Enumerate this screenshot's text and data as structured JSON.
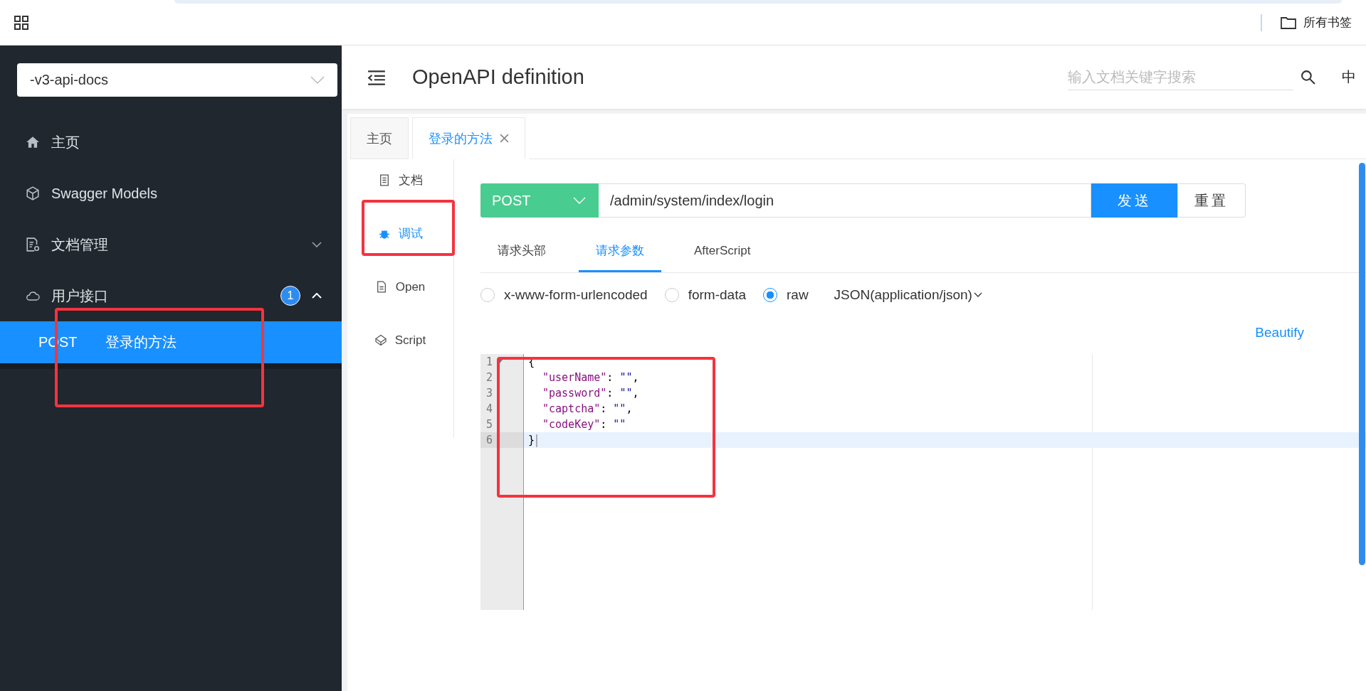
{
  "browser_bar": {
    "bookmarks_label": "所有书签"
  },
  "sidebar": {
    "group_select": {
      "value": "-v3-api-docs"
    },
    "items": [
      {
        "kind": "home",
        "label": "主页"
      },
      {
        "kind": "models",
        "label": "Swagger Models"
      },
      {
        "kind": "docs",
        "label": "文档管理",
        "expanded": false
      },
      {
        "kind": "api",
        "label": "用户接口",
        "badge": "1",
        "expanded": true,
        "children": [
          {
            "method": "POST",
            "label": "登录的方法",
            "selected": true
          }
        ]
      }
    ]
  },
  "header": {
    "title": "OpenAPI definition",
    "search": {
      "placeholder": "输入文档关键字搜索"
    },
    "language": "中"
  },
  "tabs": [
    {
      "label": "主页",
      "selected": false,
      "closable": false
    },
    {
      "label": "登录的方法",
      "selected": true,
      "closable": true
    }
  ],
  "side_menu": [
    {
      "kind": "doc",
      "label": "文档",
      "selected": false
    },
    {
      "kind": "debug",
      "label": "调试",
      "selected": true
    },
    {
      "kind": "open",
      "label": "Open",
      "selected": false
    },
    {
      "kind": "script",
      "label": "Script",
      "selected": false
    }
  ],
  "request": {
    "method": "POST",
    "url": "/admin/system/index/login",
    "buttons": [
      {
        "kind": "primary",
        "label": "发送"
      },
      {
        "kind": "default",
        "label": "重置"
      }
    ]
  },
  "param_tabs": [
    {
      "label": "请求头部",
      "selected": false
    },
    {
      "label": "请求参数",
      "selected": true
    },
    {
      "label": "AfterScript",
      "selected": false
    }
  ],
  "body_types": [
    {
      "label": "x-www-form-urlencoded",
      "selected": false
    },
    {
      "label": "form-data",
      "selected": false
    },
    {
      "label": "raw",
      "selected": true
    }
  ],
  "content_type": "JSON(application/json)",
  "beautify": "Beautify",
  "editor": {
    "lines": [
      {
        "number": "1",
        "foldable": true,
        "indented": false,
        "active": false,
        "tokens": [
          {
            "kind": "punct",
            "text": "{"
          }
        ]
      },
      {
        "number": "2",
        "foldable": false,
        "indented": true,
        "active": false,
        "tokens": [
          {
            "kind": "key",
            "text": "\"userName\""
          },
          {
            "kind": "punct",
            "text": ": "
          },
          {
            "kind": "string",
            "text": "\"\""
          },
          {
            "kind": "punct",
            "text": ","
          }
        ]
      },
      {
        "number": "3",
        "foldable": false,
        "indented": true,
        "active": false,
        "tokens": [
          {
            "kind": "key",
            "text": "\"password\""
          },
          {
            "kind": "punct",
            "text": ": "
          },
          {
            "kind": "string",
            "text": "\"\""
          },
          {
            "kind": "punct",
            "text": ","
          }
        ]
      },
      {
        "number": "4",
        "foldable": false,
        "indented": true,
        "active": false,
        "tokens": [
          {
            "kind": "key",
            "text": "\"captcha\""
          },
          {
            "kind": "punct",
            "text": ": "
          },
          {
            "kind": "string",
            "text": "\"\""
          },
          {
            "kind": "punct",
            "text": ","
          }
        ]
      },
      {
        "number": "5",
        "foldable": false,
        "indented": true,
        "active": false,
        "tokens": [
          {
            "kind": "key",
            "text": "\"codeKey\""
          },
          {
            "kind": "punct",
            "text": ": "
          },
          {
            "kind": "string",
            "text": "\"\""
          }
        ]
      },
      {
        "number": "6",
        "foldable": false,
        "indented": false,
        "active": true,
        "tokens": [
          {
            "kind": "punct",
            "text": "}"
          }
        ]
      }
    ]
  }
}
